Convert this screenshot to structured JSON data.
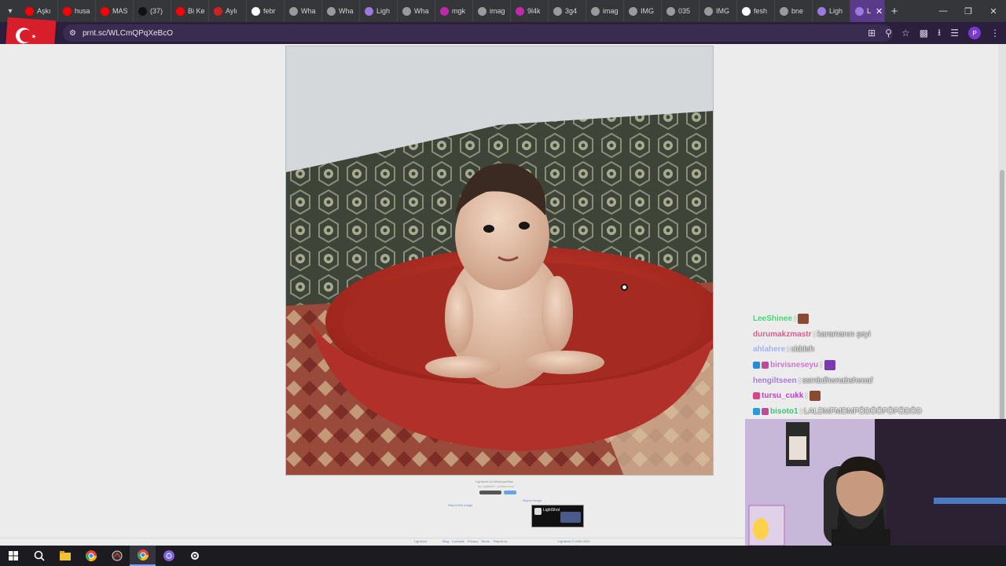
{
  "browser": {
    "tabs": [
      {
        "label": "Aşkı",
        "fav": "#ff0000"
      },
      {
        "label": "husa",
        "fav": "#ff0000"
      },
      {
        "label": "MAS",
        "fav": "#ff0000"
      },
      {
        "label": "(37)",
        "fav": "#111111"
      },
      {
        "label": "Bi Ke",
        "fav": "#ff0000"
      },
      {
        "label": "Aylı",
        "fav": "#cc2222"
      },
      {
        "label": "febr",
        "fav": "#ffffff"
      },
      {
        "label": "Wha",
        "fav": "#9a9a9a"
      },
      {
        "label": "Wha",
        "fav": "#9a9a9a"
      },
      {
        "label": "Ligh",
        "fav": "#9a7adf"
      },
      {
        "label": "Wha",
        "fav": "#9a9a9a"
      },
      {
        "label": "mgk",
        "fav": "#c02aa8"
      },
      {
        "label": "imag",
        "fav": "#9a9a9a"
      },
      {
        "label": "9l4k",
        "fav": "#c02aa8"
      },
      {
        "label": "3g4",
        "fav": "#9a9a9a"
      },
      {
        "label": "imag",
        "fav": "#9a9a9a"
      },
      {
        "label": "IMG",
        "fav": "#9a9a9a"
      },
      {
        "label": "035",
        "fav": "#9a9a9a"
      },
      {
        "label": "IMG",
        "fav": "#9a9a9a"
      },
      {
        "label": "fesh",
        "fav": "#ffffff"
      },
      {
        "label": "bne",
        "fav": "#9a9a9a"
      },
      {
        "label": "Ligh",
        "fav": "#9a7adf"
      },
      {
        "label": "L",
        "fav": "#9a7adf",
        "active": true
      }
    ],
    "url": "prnt.sc/WLCmQPqXeBcO",
    "new_tab": "+",
    "profile_initial": "P"
  },
  "page": {
    "caption_line1": "Lightshot for Windows/Mac",
    "caption_line2": "by Lightshot · prntscr.com",
    "link_left": "Report this image",
    "link_right": "Report image",
    "ad_title": "LightShot",
    "footer": [
      "Lightshot",
      "Blog",
      "Contacts",
      "Privacy",
      "Terms",
      "Report us",
      "Lightshot © 2009-2024"
    ]
  },
  "chat": [
    {
      "user": "LeeShinee",
      "color": "#3fd86a",
      "msg": "",
      "emote": "#8a4a32",
      "badges": []
    },
    {
      "user": "durumakzmastr",
      "color": "#d85a8a",
      "msg": "karamanın şeyi",
      "emote": null,
      "badges": []
    },
    {
      "user": "ahlahere",
      "color": "#9ab0ff",
      "msg": "ciddeh",
      "emote": null,
      "badges": []
    },
    {
      "user": "birvisneseyu",
      "color": "#d46ad0",
      "msg": "",
      "emote": "#7a3ab0",
      "badges": [
        "#2a8ad8",
        "#c04a9a"
      ]
    },
    {
      "user": "hengiltseen",
      "color": "#a07ae0",
      "msg": "ssrnbdhwnabsheoaf",
      "emote": null,
      "badges": []
    },
    {
      "user": "tursu_cukk",
      "color": "#c03ad0",
      "msg": "",
      "emote": "#8a4a32",
      "badges": [
        "#d04a8a"
      ]
    },
    {
      "user": "bisoto1",
      "color": "#30c86a",
      "msg": "LALDMFMDMFÖDÖÖFÖFÖDÖD",
      "emote": null,
      "badges": [
        "#2a9ad8",
        "#c04a9a"
      ]
    }
  ],
  "colors": {
    "tabbar": "#35363a",
    "addressbar": "#2b1f3d",
    "page_bg": "#ececec",
    "taskbar": "#1b1b20",
    "flag_red": "#d81e2b"
  },
  "icons": {
    "address": [
      "site-info-icon"
    ],
    "toolbar": [
      "install-icon",
      "zoom-icon",
      "bookmark-star-icon",
      "extensions-icon",
      "download-icon",
      "media-icon",
      "profile-icon",
      "menu-icon"
    ],
    "taskbar": [
      "windows-start-icon",
      "search-icon",
      "file-explorer-icon",
      "chrome-icon",
      "app-icon",
      "chrome-active-icon",
      "chrome-profile-icon",
      "settings-icon"
    ]
  }
}
